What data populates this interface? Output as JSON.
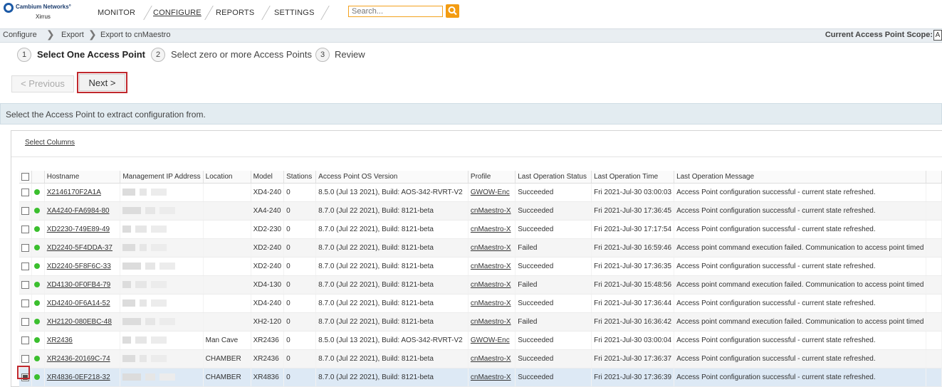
{
  "brand": {
    "name": "Cambium Networks°",
    "sub": "Xirrus"
  },
  "nav": {
    "items": [
      "MONITOR",
      "CONFIGURE",
      "REPORTS",
      "SETTINGS"
    ],
    "active": "CONFIGURE"
  },
  "search": {
    "placeholder": "Search..."
  },
  "breadcrumb": [
    "Configure",
    "Export",
    "Export to cnMaestro"
  ],
  "scope": {
    "label": "Current Access Point Scope:",
    "value": "A"
  },
  "wizard": {
    "steps": [
      {
        "num": "1",
        "label": "Select One Access Point",
        "active": true
      },
      {
        "num": "2",
        "label": "Select zero or more Access Points",
        "active": false
      },
      {
        "num": "3",
        "label": "Review",
        "active": false
      }
    ]
  },
  "buttons": {
    "previous": "< Previous",
    "next": "Next >"
  },
  "banner": {
    "text": "Select the Access Point to extract configuration from."
  },
  "grid": {
    "select_columns": "Select Columns",
    "columns": [
      "Hostname",
      "Management IP Address",
      "Location",
      "Model",
      "Stations",
      "Access Point OS Version",
      "Profile",
      "Last Operation Status",
      "Last Operation Time",
      "Last Operation Message"
    ],
    "rows": [
      {
        "hostname": "X2146170F2A1A",
        "location": "",
        "model": "XD4-240",
        "stations": "0",
        "os": "8.5.0 (Jul 13 2021), Build: AOS-342-RVRT-V2",
        "profile": "GWOW-Enc",
        "status": "Succeeded",
        "time": "Fri 2021-Jul-30 03:00:03",
        "message": "Access Point configuration successful - current state refreshed.",
        "checked": false
      },
      {
        "hostname": "XA4240-FA6984-80",
        "location": "",
        "model": "XA4-240",
        "stations": "0",
        "os": "8.7.0 (Jul 22 2021), Build: 8121-beta",
        "profile": "cnMaestro-X",
        "status": "Succeeded",
        "time": "Fri 2021-Jul-30 17:36:45",
        "message": "Access Point configuration successful - current state refreshed.",
        "checked": false
      },
      {
        "hostname": "XD2230-749E89-49",
        "location": "",
        "model": "XD2-230",
        "stations": "0",
        "os": "8.7.0 (Jul 22 2021), Build: 8121-beta",
        "profile": "cnMaestro-X",
        "status": "Succeeded",
        "time": "Fri 2021-Jul-30 17:17:54",
        "message": "Access Point configuration successful - current state refreshed.",
        "checked": false
      },
      {
        "hostname": "XD2240-5F4DDA-37",
        "location": "",
        "model": "XD2-240",
        "stations": "0",
        "os": "8.7.0 (Jul 22 2021), Build: 8121-beta",
        "profile": "cnMaestro-X",
        "status": "Failed",
        "time": "Fri 2021-Jul-30 16:59:46",
        "message": "Access point command execution failed. Communication to access point timed",
        "checked": false
      },
      {
        "hostname": "XD2240-5F8F6C-33",
        "location": "",
        "model": "XD2-240",
        "stations": "0",
        "os": "8.7.0 (Jul 22 2021), Build: 8121-beta",
        "profile": "cnMaestro-X",
        "status": "Succeeded",
        "time": "Fri 2021-Jul-30 17:36:35",
        "message": "Access Point configuration successful - current state refreshed.",
        "checked": false
      },
      {
        "hostname": "XD4130-0F0FB4-79",
        "location": "",
        "model": "XD4-130",
        "stations": "0",
        "os": "8.7.0 (Jul 22 2021), Build: 8121-beta",
        "profile": "cnMaestro-X",
        "status": "Failed",
        "time": "Fri 2021-Jul-30 15:48:56",
        "message": "Access point command execution failed. Communication to access point timed",
        "checked": false
      },
      {
        "hostname": "XD4240-0F6A14-52",
        "location": "",
        "model": "XD4-240",
        "stations": "0",
        "os": "8.7.0 (Jul 22 2021), Build: 8121-beta",
        "profile": "cnMaestro-X",
        "status": "Succeeded",
        "time": "Fri 2021-Jul-30 17:36:44",
        "message": "Access Point configuration successful - current state refreshed.",
        "checked": false
      },
      {
        "hostname": "XH2120-080EBC-48",
        "location": "",
        "model": "XH2-120",
        "stations": "0",
        "os": "8.7.0 (Jul 22 2021), Build: 8121-beta",
        "profile": "cnMaestro-X",
        "status": "Failed",
        "time": "Fri 2021-Jul-30 16:36:42",
        "message": "Access point command execution failed. Communication to access point timed",
        "checked": false
      },
      {
        "hostname": "XR2436",
        "location": "Man Cave",
        "model": "XR2436",
        "stations": "0",
        "os": "8.5.0 (Jul 13 2021), Build: AOS-342-RVRT-V2",
        "profile": "GWOW-Enc",
        "status": "Succeeded",
        "time": "Fri 2021-Jul-30 03:00:04",
        "message": "Access Point configuration successful - current state refreshed.",
        "checked": false
      },
      {
        "hostname": "XR2436-20169C-74",
        "location": "CHAMBER",
        "model": "XR2436",
        "stations": "0",
        "os": "8.7.0 (Jul 22 2021), Build: 8121-beta",
        "profile": "cnMaestro-X",
        "status": "Succeeded",
        "time": "Fri 2021-Jul-30 17:36:37",
        "message": "Access Point configuration successful - current state refreshed.",
        "checked": false
      },
      {
        "hostname": "XR4836-0EF218-32",
        "location": "CHAMBER",
        "model": "XR4836",
        "stations": "0",
        "os": "8.7.0 (Jul 22 2021), Build: 8121-beta",
        "profile": "cnMaestro-X",
        "status": "Succeeded",
        "time": "Fri 2021-Jul-30 17:36:39",
        "message": "Access Point configuration successful - current state refreshed.",
        "checked": true
      }
    ]
  },
  "colors": {
    "accent": "#c0282d",
    "status_online": "#3bbf2e",
    "search_border": "#f3a21f"
  }
}
